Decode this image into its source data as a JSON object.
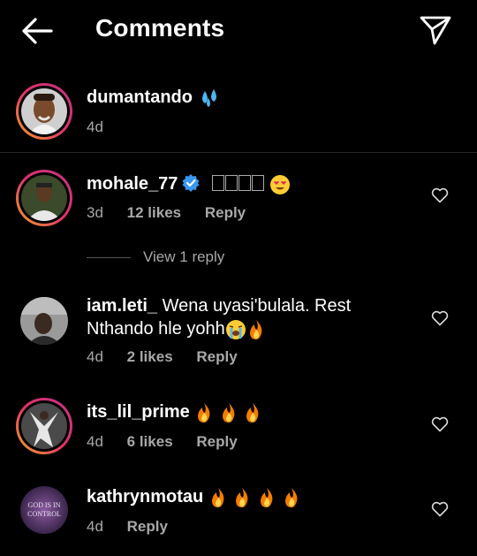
{
  "header": {
    "title": "Comments"
  },
  "post": {
    "username": "dumantando",
    "time": "4d"
  },
  "comments": [
    {
      "username": "mohale_77",
      "time": "3d",
      "likes": "12 likes",
      "reply": "Reply",
      "view_replies": "View 1 reply"
    },
    {
      "username": "iam.leti_",
      "text1": "Wena uyasi'bulala. Rest",
      "text2": "Nthando hle yohh",
      "time": "4d",
      "likes": "2 likes",
      "reply": "Reply"
    },
    {
      "username": "its_lil_prime",
      "time": "4d",
      "likes": "6 likes",
      "reply": "Reply"
    },
    {
      "username": "kathrynmotau",
      "time": "4d",
      "reply": "Reply",
      "avatar_text": "GOD IS IN CONTROL"
    }
  ],
  "colors": {
    "background": "#000000",
    "muted": "#a8a8a8",
    "verified": "#3897f0"
  }
}
